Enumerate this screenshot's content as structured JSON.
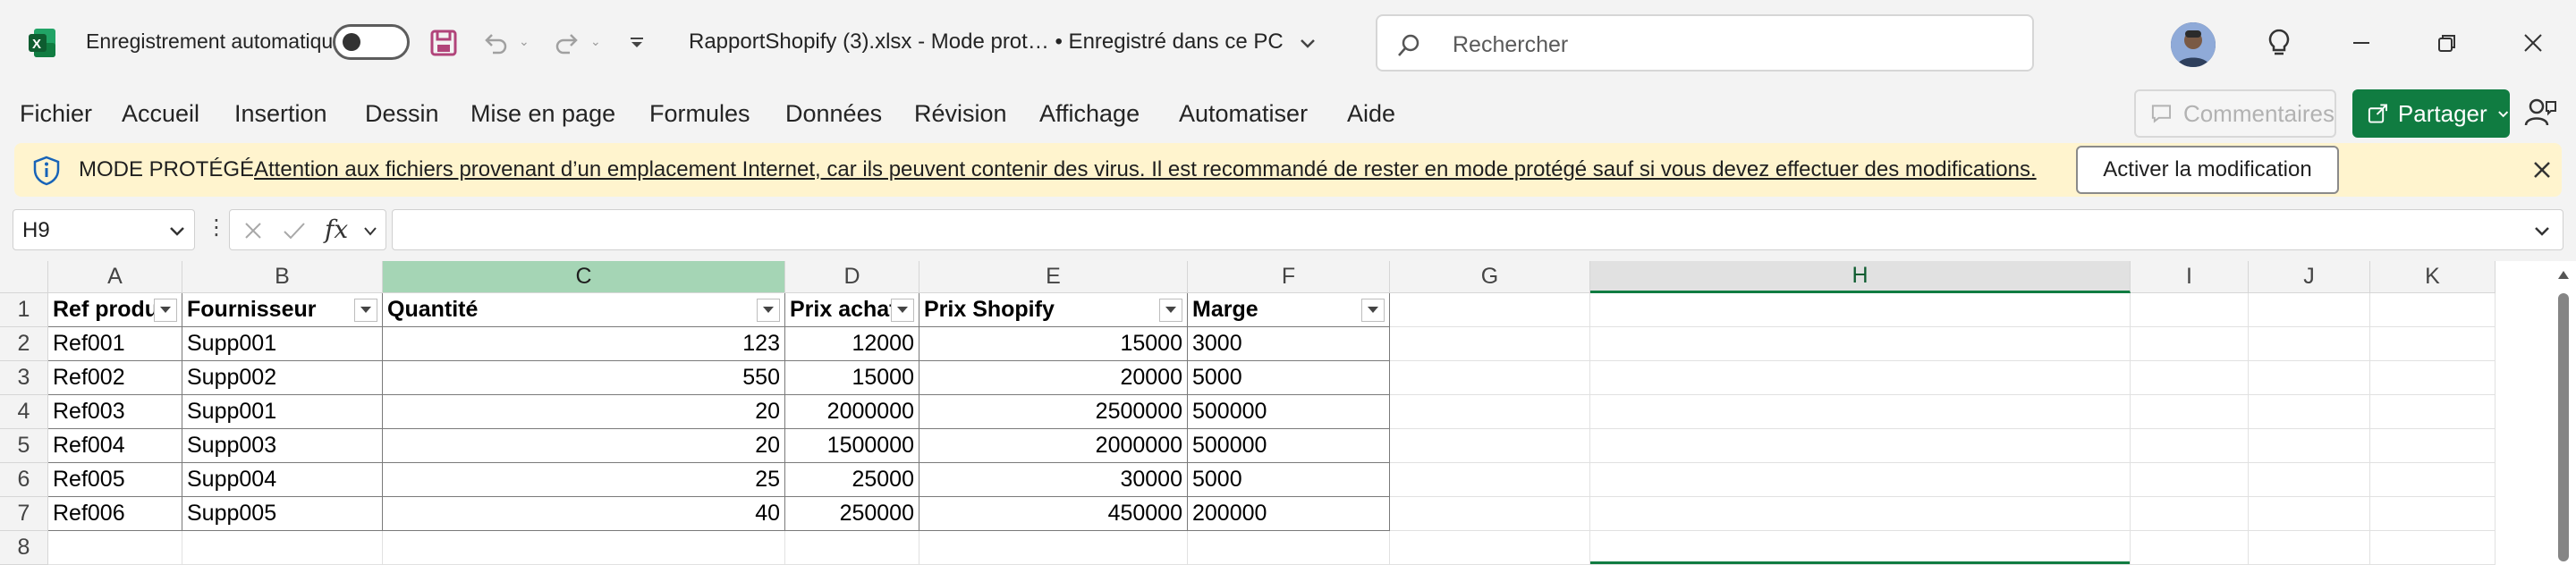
{
  "titlebar": {
    "autosave_label": "Enregistrement automatique",
    "document_title": "RapportShopify (3).xlsx  -  Mode prot…  •  Enregistré dans ce PC",
    "search_placeholder": "Rechercher",
    "accent": "#107c41"
  },
  "menu": {
    "items": [
      "Fichier",
      "Accueil",
      "Insertion",
      "Dessin",
      "Mise en page",
      "Formules",
      "Données",
      "Révision",
      "Affichage",
      "Automatiser",
      "Aide"
    ],
    "comments_label": "Commentaires",
    "share_label": "Partager"
  },
  "banner": {
    "title": "MODE PROTÉGÉ",
    "message": "Attention aux fichiers provenant d’un emplacement Internet, car ils peuvent contenir des virus. Il est recommandé de rester en mode protégé sauf si vous devez effectuer des modifications.",
    "enable_label": "Activer la modification",
    "color": "#fff4ce"
  },
  "formula_bar": {
    "name_box": "H9",
    "fx_label": "fx",
    "formula": ""
  },
  "grid": {
    "columns": [
      "A",
      "B",
      "C",
      "D",
      "E",
      "F",
      "G",
      "H",
      "I",
      "J",
      "K"
    ],
    "rows": [
      "1",
      "2",
      "3",
      "4",
      "5",
      "6",
      "7",
      "8"
    ],
    "table_headers": [
      "Ref produ",
      "Fournisseur",
      "Quantité",
      "Prix achat",
      "Prix Shopify",
      "Marge"
    ],
    "table_rows": [
      [
        "Ref001",
        "Supp001",
        "123",
        "12000",
        "15000",
        "3000"
      ],
      [
        "Ref002",
        "Supp002",
        "550",
        "15000",
        "20000",
        "5000"
      ],
      [
        "Ref003",
        "Supp001",
        "20",
        "2000000",
        "2500000",
        "500000"
      ],
      [
        "Ref004",
        "Supp003",
        "20",
        "1500000",
        "2000000",
        "500000"
      ],
      [
        "Ref005",
        "Supp004",
        "25",
        "25000",
        "30000",
        "5000"
      ],
      [
        "Ref006",
        "Supp005",
        "40",
        "250000",
        "450000",
        "200000"
      ]
    ]
  }
}
